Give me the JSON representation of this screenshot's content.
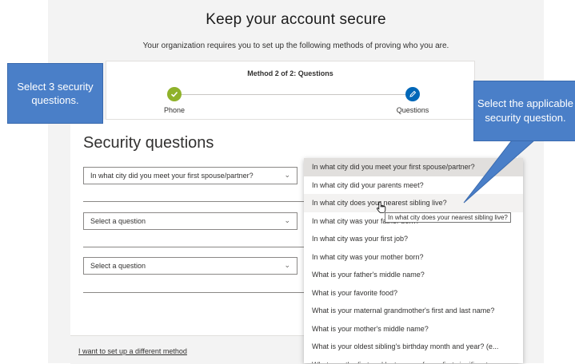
{
  "page": {
    "title": "Keep your account secure",
    "subtitle": "Your organization requires you to set up the following methods of proving who you are."
  },
  "progress": {
    "method_label": "Method 2 of 2: Questions",
    "steps": [
      {
        "label": "Phone",
        "status": "done",
        "icon": "check-icon"
      },
      {
        "label": "Questions",
        "status": "current",
        "icon": "pencil-icon"
      }
    ]
  },
  "form": {
    "heading": "Security questions",
    "selects": [
      {
        "value": "In what city did you meet your first spouse/partner?"
      },
      {
        "value": "Select a question"
      },
      {
        "value": "Select a question"
      }
    ],
    "different_method_link": "I want to set up a different method"
  },
  "dropdown": {
    "options": [
      "In what city did you meet your first spouse/partner?",
      "In what city did your parents meet?",
      "In what city does your nearest sibling live?",
      "In what city was your father born?",
      "In what city was your first job?",
      "In what city was your mother born?",
      "What is your father's middle name?",
      "What is your favorite food?",
      "What is your maternal grandmother's first and last name?",
      "What is your mother's middle name?",
      "What is your oldest sibling's birthday month and year? (e...",
      "What was the first and last name of your first significant ..."
    ],
    "selected_index": 0,
    "hover_index": 2,
    "tooltip": "In what city does your nearest sibling live?"
  },
  "callouts": {
    "left": "Select 3 security questions.",
    "right": "Select the applicable security question."
  },
  "colors": {
    "accent": "#0067b8",
    "done": "#8fb22a",
    "callout": "#4a7fc8"
  }
}
